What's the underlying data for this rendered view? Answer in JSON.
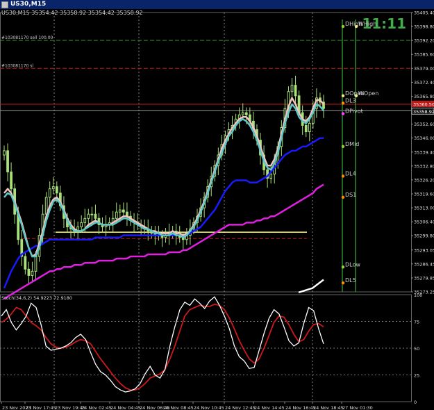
{
  "window": {
    "title": "US30,M15"
  },
  "header": {
    "symbol_line": "US30,M15  35354.42 35358.92 35354.42 35358.92"
  },
  "clock": "11:11",
  "colors": {
    "background": "#000000",
    "grid": "#3a3a3a",
    "candle": "#a8e07a",
    "ema_fast_pink": "#f2c6c0",
    "ema_cyan": "#5ec8c8",
    "ema_blue": "#1a1aff",
    "ema_magenta": "#e020e0",
    "ema_white": "#ffffff",
    "level_line": "#ffff66",
    "stoch_main": "#ffffff",
    "stoch_signal": "#cc1a1a",
    "day_line": "#2e8b2e",
    "sell_line": "#2e8b2e",
    "sl_line": "#c01818",
    "bid_line": "#c01818"
  },
  "order_labels": {
    "sell": "#103081170 sell 100.00",
    "sl": "#103081170 sl"
  },
  "price_boxes": {
    "bid": "35360.50",
    "current": "35358.92"
  },
  "chart_data": [
    {
      "type": "candlestick",
      "title": "US30,M15",
      "price_ticks": [
        "35405.40",
        "35398.80",
        "35392.20",
        "35385.60",
        "35379.00",
        "35372.40",
        "35365.80",
        "35359.20",
        "35352.60",
        "35346.00",
        "35339.40",
        "35332.80",
        "35326.20",
        "35319.60",
        "35313.00",
        "35306.40",
        "35299.80",
        "35293.05",
        "35286.45",
        "35279.85",
        "35273.25"
      ],
      "price_range": [
        35273.25,
        35405.4
      ],
      "sell_price": 35392.2,
      "sl_price": 35379.0,
      "bid_line": 35362.0,
      "current_price": 35358.92,
      "level_line": 35301.5,
      "level_dashed": 35298.5,
      "closes": [
        35340,
        35330,
        35322,
        35310,
        35298,
        35290,
        35284,
        35281,
        35283,
        35290,
        35300,
        35310,
        35318,
        35322,
        35323,
        35320,
        35314,
        35308,
        35304,
        35303,
        35302,
        35304,
        35306,
        35308,
        35310,
        35310,
        35308,
        35305,
        35304,
        35305,
        35306,
        35308,
        35311,
        35312,
        35311,
        35309,
        35307,
        35306,
        35305,
        35304,
        35303,
        35302,
        35301,
        35300,
        35300,
        35299,
        35300,
        35301,
        35302,
        35300,
        35299,
        35298,
        35300,
        35303,
        35306,
        35309,
        35313,
        35318,
        35323,
        35328,
        35333,
        35338,
        35343,
        35347,
        35350,
        35352,
        35355,
        35357,
        35358,
        35357,
        35354,
        35350,
        35345,
        35338,
        35331,
        35327,
        35329,
        35334,
        35342,
        35351,
        35360,
        35368,
        35371,
        35366,
        35358,
        35352,
        35349,
        35353,
        35360,
        35365,
        35363,
        35360
      ],
      "ema_fast": [
        35320,
        35322,
        35320,
        35316,
        35311,
        35306,
        35300,
        35294,
        35290,
        35291,
        35296,
        35302,
        35309,
        35314,
        35317,
        35318,
        35316,
        35312,
        35308,
        35305,
        35303,
        35302,
        35302,
        35303,
        35305,
        35306,
        35307,
        35306,
        35305,
        35305,
        35305,
        35306,
        35307,
        35308,
        35309,
        35309,
        35308,
        35307,
        35306,
        35305,
        35304,
        35303,
        35302,
        35302,
        35301,
        35301,
        35301,
        35301,
        35302,
        35301,
        35301,
        35300,
        35301,
        35302,
        35305,
        35308,
        35312,
        35316,
        35321,
        35326,
        35331,
        35336,
        35341,
        35345,
        35348,
        35351,
        35353,
        35355,
        35356,
        35356,
        35354,
        35351,
        35347,
        35342,
        35337,
        35333,
        35333,
        35336,
        35341,
        35348,
        35355,
        35361,
        35365,
        35362,
        35358,
        35355,
        35354,
        35356,
        35360,
        35364,
        35364,
        35362
      ],
      "ema_cyan": [
        35318,
        35320,
        35319,
        35315,
        35310,
        35305,
        35299,
        35294,
        35290,
        35290,
        35294,
        35300,
        35307,
        35312,
        35316,
        35317,
        35315,
        35311,
        35307,
        35304,
        35302,
        35302,
        35302,
        35303,
        35304,
        35305,
        35306,
        35306,
        35305,
        35305,
        35305,
        35305,
        35306,
        35307,
        35308,
        35308,
        35307,
        35306,
        35305,
        35304,
        35303,
        35303,
        35302,
        35301,
        35301,
        35300,
        35300,
        35300,
        35301,
        35300,
        35300,
        35299,
        35300,
        35302,
        35304,
        35307,
        35311,
        35315,
        35320,
        35325,
        35330,
        35335,
        35339,
        35343,
        35347,
        35349,
        35352,
        35354,
        35355,
        35354,
        35352,
        35349,
        35345,
        35340,
        35335,
        35332,
        35331,
        35334,
        35339,
        35346,
        35353,
        35358,
        35362,
        35360,
        35356,
        35354,
        35353,
        35355,
        35358,
        35362,
        35361,
        35359
      ],
      "ema_blue": [
        35275,
        35279,
        35283,
        35286,
        35289,
        35291,
        35292,
        35293,
        35294,
        35295,
        35295,
        35296,
        35297,
        35298,
        35298,
        35298,
        35298,
        35298,
        35298,
        35298,
        35298,
        35298,
        35298,
        35298,
        35298,
        35298,
        35299,
        35299,
        35299,
        35299,
        35299,
        35299,
        35299,
        35299,
        35300,
        35300,
        35300,
        35300,
        35300,
        35300,
        35300,
        35300,
        35300,
        35300,
        35300,
        35300,
        35300,
        35300,
        35300,
        35300,
        35300,
        35300,
        35300,
        35301,
        35302,
        35303,
        35304,
        35306,
        35308,
        35310,
        35312,
        35315,
        35318,
        35321,
        35323,
        35325,
        35326,
        35326,
        35326,
        35326,
        35325,
        35325,
        35325,
        35326,
        35327,
        35328,
        35330,
        35332,
        35334,
        35336,
        35338,
        35339,
        35340,
        35340,
        35341,
        35342,
        35342,
        35343,
        35344,
        35345,
        35346,
        35346
      ],
      "ema_magenta": [
        35270,
        35271,
        35272,
        35273,
        35274,
        35275,
        35276,
        35277,
        35278,
        35279,
        35280,
        35281,
        35282,
        35283,
        35283,
        35284,
        35284,
        35285,
        35285,
        35285,
        35286,
        35286,
        35286,
        35287,
        35287,
        35287,
        35287,
        35288,
        35288,
        35288,
        35288,
        35288,
        35289,
        35289,
        35289,
        35289,
        35290,
        35290,
        35290,
        35290,
        35290,
        35291,
        35291,
        35291,
        35291,
        35291,
        35291,
        35292,
        35292,
        35292,
        35292,
        35293,
        35293,
        35294,
        35295,
        35296,
        35297,
        35298,
        35299,
        35300,
        35301,
        35302,
        35303,
        35304,
        35305,
        35305,
        35305,
        35305,
        35305,
        35306,
        35306,
        35306,
        35307,
        35307,
        35308,
        35308,
        35309,
        35309,
        35310,
        35311,
        35312,
        35313,
        35314,
        35315,
        35316,
        35317,
        35318,
        35319,
        35320,
        35322,
        35323,
        35324
      ],
      "day_levels": [
        {
          "label": "DHigh",
          "price": 35398.8,
          "color": "#9acd32"
        },
        {
          "label": "WHigh",
          "price": 35398.8,
          "color": "#f0e68c"
        },
        {
          "label": "DOpen",
          "price": 35366.0,
          "color": "#f0e68c"
        },
        {
          "label": "WOpen",
          "price": 35366.0,
          "color": "#f0e68c"
        },
        {
          "label": "DL3",
          "price": 35362.5,
          "color": "#ff8c00"
        },
        {
          "label": "DPivot",
          "price": 35359.5,
          "color": "#ff40ff"
        },
        {
          "label": "DMid",
          "price": 35342.0,
          "color": "#9acd32"
        },
        {
          "label": "DL4",
          "price": 35328.0,
          "color": "#ff8c00"
        },
        {
          "label": "DS1",
          "price": 35318.0,
          "color": "#ff8c00"
        },
        {
          "label": "DLow",
          "price": 35285.0,
          "color": "#9acd32"
        },
        {
          "label": "DL5",
          "price": 35277.5,
          "color": "#ff8c00"
        }
      ]
    },
    {
      "type": "line",
      "title": "Stoch(34,6,2) 54.9223 72.9180",
      "y_ticks": [
        "100",
        "75",
        "50",
        "25",
        "0"
      ],
      "ylim": [
        0,
        100
      ],
      "x_ticks": [
        "23 Nov 2023",
        "23 Nov 17:45",
        "23 Nov 19:45",
        "24 Nov 02:45",
        "24 Nov 04:45",
        "24 Nov 06:45",
        "24 Nov 08:45",
        "24 Nov 10:45",
        "24 Nov 12:45",
        "24 Nov 14:45",
        "24 Nov 16:45",
        "24 Nov 18:45",
        "27 Nov 01:30"
      ],
      "series": [
        {
          "role": "main",
          "values": [
            80,
            86,
            74,
            67,
            73,
            80,
            92,
            88,
            72,
            52,
            48,
            49,
            50,
            52,
            55,
            60,
            63,
            58,
            46,
            35,
            28,
            25,
            20,
            14,
            11,
            9,
            10,
            12,
            17,
            26,
            33,
            25,
            22,
            30,
            52,
            70,
            86,
            93,
            90,
            96,
            92,
            87,
            94,
            98,
            90,
            80,
            68,
            52,
            42,
            38,
            31,
            32,
            48,
            64,
            78,
            86,
            82,
            70,
            57,
            52,
            55,
            73,
            88,
            85,
            68,
            54
          ]
        },
        {
          "role": "signal",
          "values": [
            74,
            77,
            82,
            88,
            86,
            80,
            74,
            71,
            67,
            60,
            54,
            51,
            50,
            51,
            53,
            56,
            58,
            57,
            54,
            47,
            40,
            34,
            28,
            22,
            17,
            13,
            11,
            11,
            13,
            17,
            22,
            24,
            26,
            30,
            40,
            52,
            66,
            80,
            86,
            88,
            90,
            89,
            89,
            91,
            90,
            86,
            78,
            68,
            57,
            48,
            40,
            36,
            40,
            50,
            62,
            74,
            80,
            79,
            72,
            63,
            56,
            58,
            66,
            72,
            73,
            70
          ]
        }
      ]
    }
  ]
}
